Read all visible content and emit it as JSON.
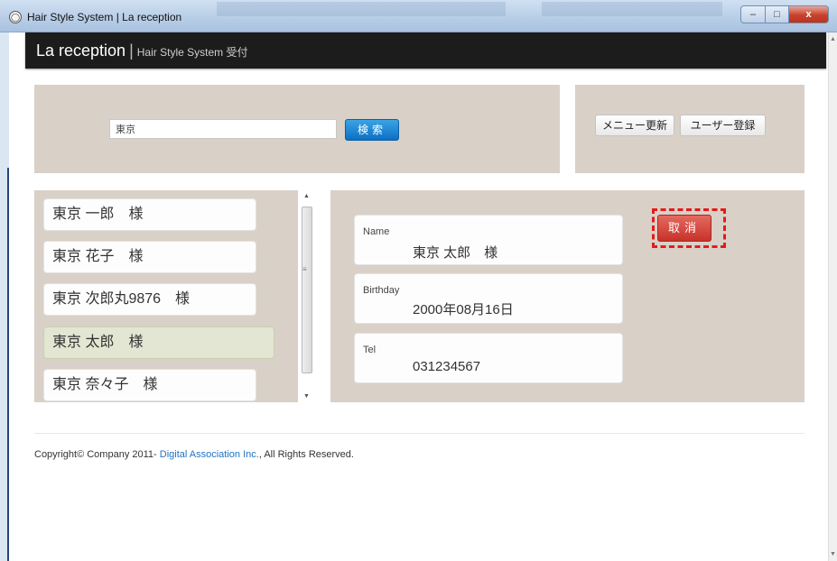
{
  "window": {
    "title": "Hair Style System | La reception",
    "min_label": "–",
    "max_label": "□",
    "close_label": "x"
  },
  "header": {
    "brand": "La reception",
    "separator": "|",
    "subtitle": "Hair Style System 受付"
  },
  "search": {
    "value": "東京",
    "button_label": "検索"
  },
  "menu": {
    "update_label": "メニュー更新",
    "register_label": "ユーザー登録"
  },
  "customers": [
    {
      "label": "東京 一郎　様",
      "active": false
    },
    {
      "label": "東京 花子　様",
      "active": false
    },
    {
      "label": "東京 次郎丸9876　様",
      "active": false
    },
    {
      "label": "東京 太郎　様",
      "active": true
    },
    {
      "label": "東京 奈々子　様",
      "active": false
    }
  ],
  "detail": {
    "name_label": "Name",
    "name_value": "東京 太郎　様",
    "birthday_label": "Birthday",
    "birthday_value": "2000年08月16日",
    "tel_label": "Tel",
    "tel_value": "031234567",
    "cancel_label": "取消"
  },
  "footer": {
    "prefix": "Copyright© Company 2011- ",
    "link": "Digital Association Inc.",
    "suffix": ", All Rights Reserved."
  },
  "colors": {
    "panel": "#d9d0c7",
    "header_bg": "#1c1c1c",
    "search_button": "#1a7fd0",
    "cancel_button": "#d4463c",
    "highlight_border": "#e31b1b",
    "active_item": "#e2e6d2",
    "link": "#1f72c4"
  }
}
